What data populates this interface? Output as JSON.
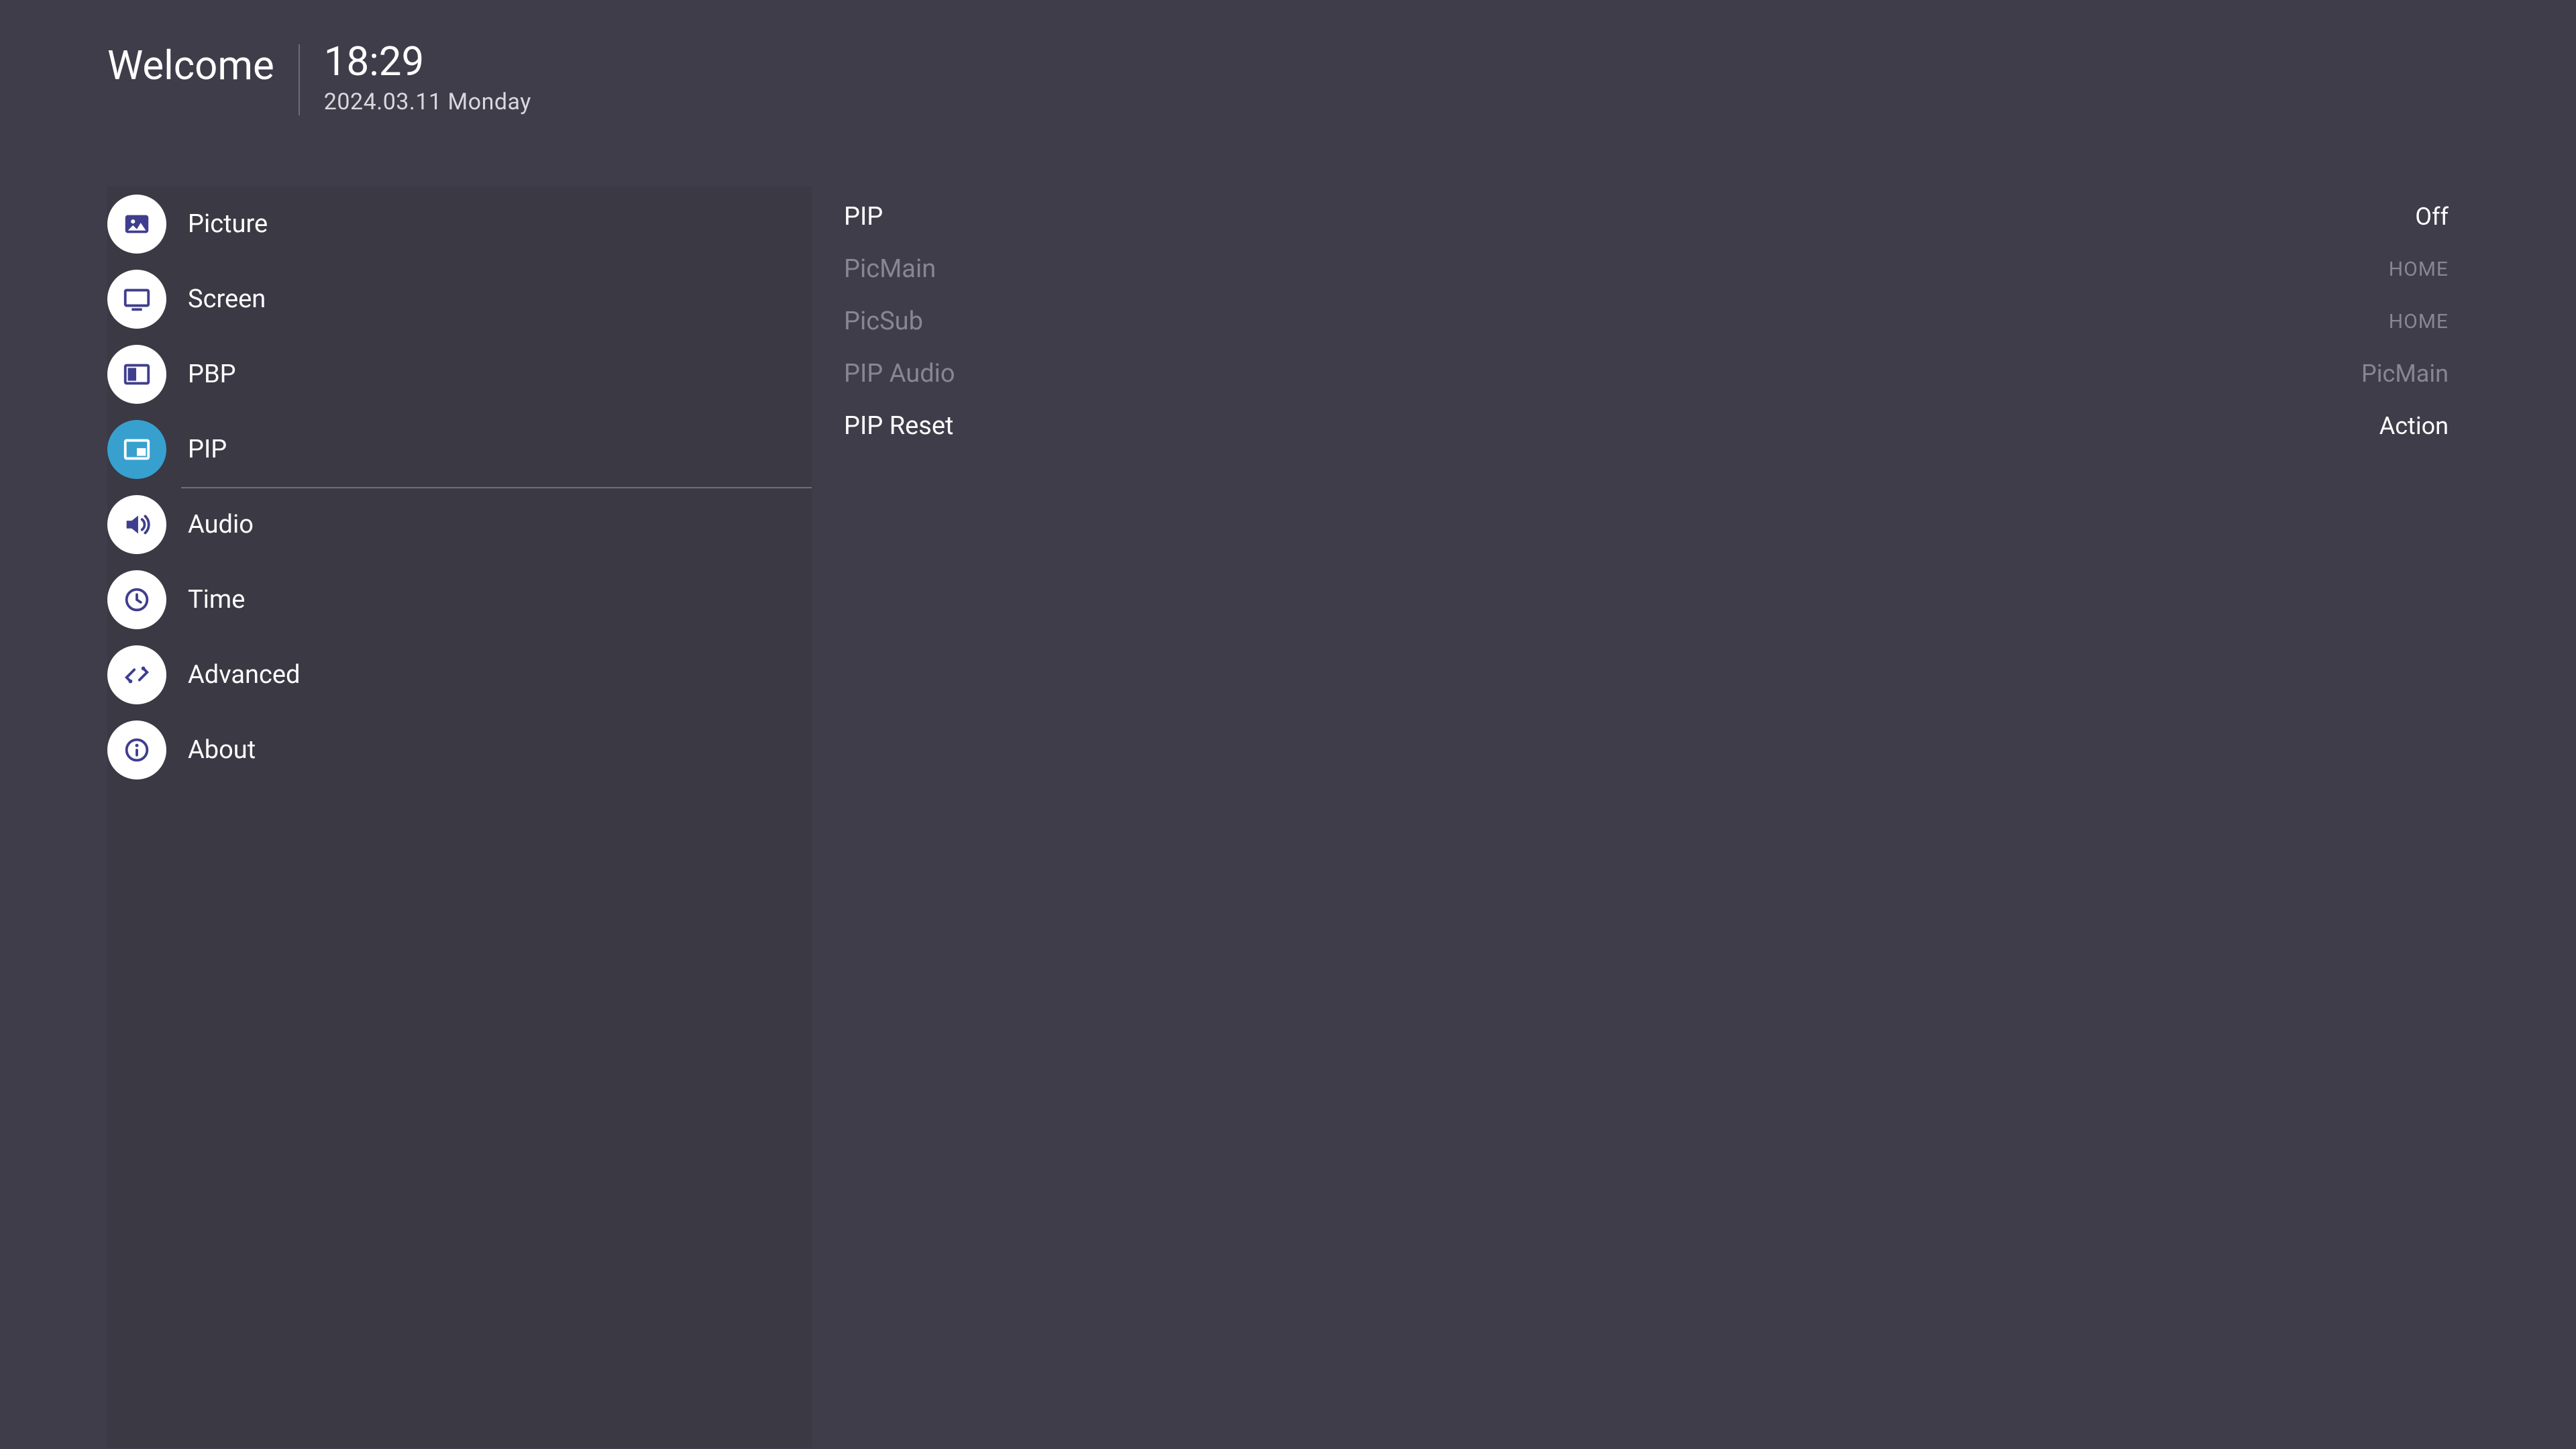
{
  "header": {
    "welcome": "Welcome",
    "time": "18:29",
    "date": "2024.03.11 Monday"
  },
  "sidebar": {
    "items": [
      {
        "id": "picture",
        "label": "Picture",
        "icon": "picture-icon",
        "active": false
      },
      {
        "id": "screen",
        "label": "Screen",
        "icon": "screen-icon",
        "active": false
      },
      {
        "id": "pbp",
        "label": "PBP",
        "icon": "pbp-icon",
        "active": false
      },
      {
        "id": "pip",
        "label": "PIP",
        "icon": "pip-icon",
        "active": true
      },
      {
        "id": "audio",
        "label": "Audio",
        "icon": "audio-icon",
        "active": false
      },
      {
        "id": "time",
        "label": "Time",
        "icon": "time-icon",
        "active": false
      },
      {
        "id": "advanced",
        "label": "Advanced",
        "icon": "advanced-icon",
        "active": false
      },
      {
        "id": "about",
        "label": "About",
        "icon": "about-icon",
        "active": false
      }
    ]
  },
  "content": {
    "rows": [
      {
        "id": "pip",
        "name": "PIP",
        "value": "Off",
        "enabled": true,
        "small": false
      },
      {
        "id": "picmain",
        "name": "PicMain",
        "value": "HOME",
        "enabled": false,
        "small": true
      },
      {
        "id": "picsub",
        "name": "PicSub",
        "value": "HOME",
        "enabled": false,
        "small": true
      },
      {
        "id": "pipaudio",
        "name": "PIP Audio",
        "value": "PicMain",
        "enabled": false,
        "small": false
      },
      {
        "id": "pipreset",
        "name": "PIP Reset",
        "value": "Action",
        "enabled": true,
        "small": false
      }
    ]
  }
}
